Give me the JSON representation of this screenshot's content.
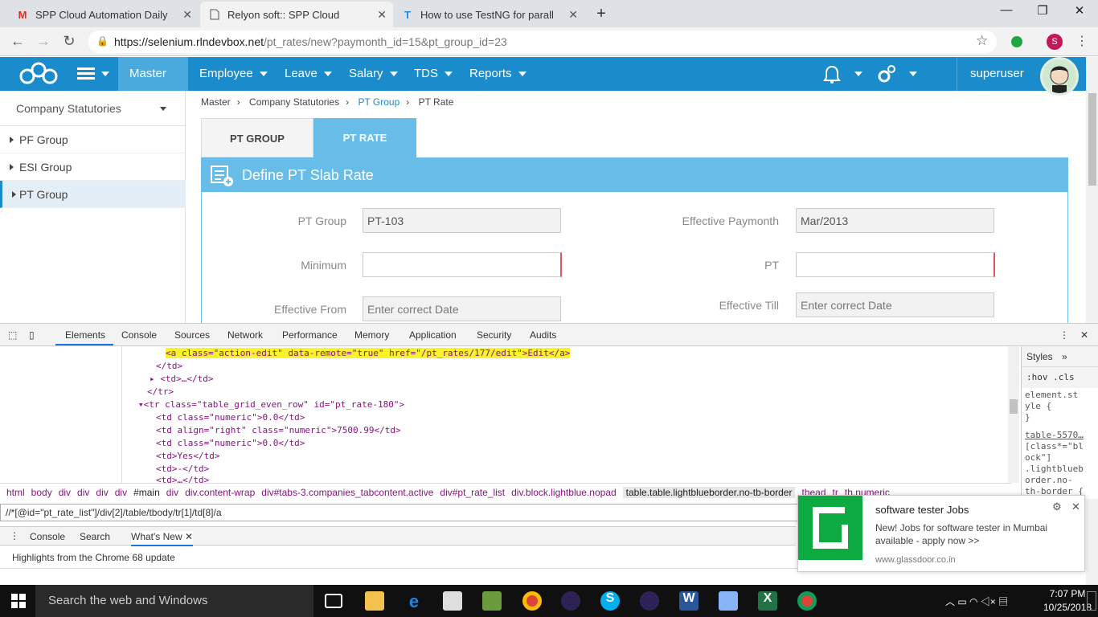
{
  "browser": {
    "tabs": [
      {
        "title": "SPP Cloud Automation Daily Stat",
        "icon": "gmail-icon"
      },
      {
        "title": "Relyon soft:: SPP Cloud",
        "icon": "page-icon"
      },
      {
        "title": "How to use TestNG for parallel te",
        "icon": "tutorial-icon"
      }
    ],
    "url_host": "https://selenium.rlndevbox.net",
    "url_path": "/pt_rates/new?paymonth_id=15&pt_group_id=23",
    "profile_initial": "S"
  },
  "nav": {
    "items": [
      "Master",
      "Employee",
      "Leave",
      "Salary",
      "TDS",
      "Reports"
    ],
    "active": "Master",
    "user": "superuser"
  },
  "sidebar": {
    "header": "Company Statutories",
    "items": [
      "PF Group",
      "ESI Group",
      "PT Group"
    ]
  },
  "breadcrumb": [
    "Master",
    "Company Statutories",
    "PT Group",
    "PT Rate"
  ],
  "tabs": [
    "PT GROUP",
    "PT RATE"
  ],
  "panel_title": "Define PT Slab Rate",
  "form": {
    "pt_group_label": "PT Group",
    "pt_group_value": "PT-103",
    "eff_paymonth_label": "Effective Paymonth",
    "eff_paymonth_value": "Mar/2013",
    "minimum_label": "Minimum",
    "pt_label": "PT",
    "eff_from_label": "Effective From",
    "eff_from_placeholder": "Enter correct Date",
    "eff_till_label": "Effective Till",
    "eff_till_placeholder": "Enter correct Date"
  },
  "devtools": {
    "tabs": [
      "Elements",
      "Console",
      "Sources",
      "Network",
      "Performance",
      "Memory",
      "Application",
      "Security",
      "Audits"
    ],
    "code_lines": [
      "<a class=\"action-edit\" data-remote=\"true\" href=\"/pt_rates/177/edit\">Edit</a>",
      "</td>",
      "<td>…</td>",
      "</tr>",
      "<tr class=\"table_grid_even_row\" id=\"pt_rate-180\">",
      "<td class=\"numeric\">0.0</td>",
      "<td align=\"right\" class=\"numeric\">7500.99</td>",
      "<td class=\"numeric\">0.0</td>",
      "<td>Yes</td>",
      "<td>-</td>",
      "<td>…</td>"
    ],
    "crumbs": [
      "html",
      "body",
      "div",
      "div",
      "div",
      "div",
      "#main",
      "div",
      "div.content-wrap",
      "div#tabs-3.companies_tabcontent.active",
      "div#pt_rate_list",
      "div.block.lightblue.nopad",
      "table.table.lightblueborder.no-tb-border",
      "thead",
      "tr",
      "th.numeric"
    ],
    "xpath": "//*[@id=\"pt_rate_list\"]/div[2]/table/tbody/tr[1]/td[8]/a",
    "drawer_tabs": [
      "Console",
      "Search",
      "What's New"
    ],
    "highlights": "Highlights from the Chrome 68 update",
    "styles_tab": "Styles",
    "styles_filter": ":hov  .cls",
    "styles_lines": [
      "element.st",
      "yle {",
      "}",
      "table-5570…",
      "[class*=\"bl",
      "ock\"]",
      ".lightblueb",
      "order.no-",
      "th-border {"
    ]
  },
  "notification": {
    "title": "software tester Jobs",
    "body": "New! Jobs for software tester in Mumbai available - apply now >>",
    "source": "www.glassdoor.co.in"
  },
  "taskbar": {
    "search_placeholder": "Search the web and Windows",
    "time": "7:07 PM",
    "date": "10/25/2018"
  },
  "colors": {
    "brand": "#1a8bcb",
    "panel": "#67bde8",
    "active_tab": "#4aa9dd"
  }
}
